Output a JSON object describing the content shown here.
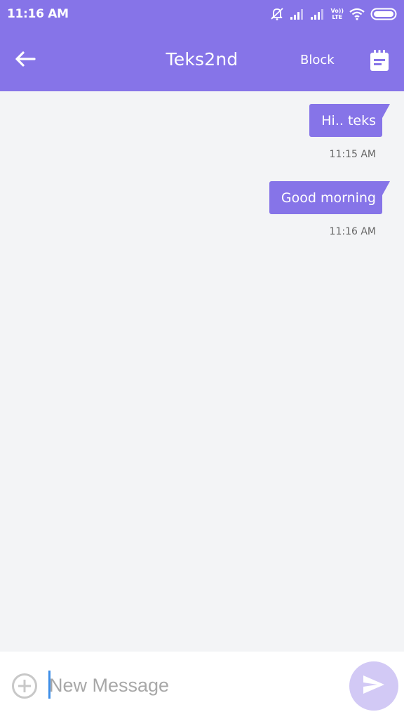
{
  "status_bar": {
    "time": "11:16 AM",
    "icons": [
      "bell-muted-icon",
      "signal-icon",
      "signal-icon",
      "volte-icon",
      "wifi-icon",
      "battery-icon"
    ],
    "volte_label_top": "Vo))",
    "volte_label_bottom": "LTE"
  },
  "app_bar": {
    "back_icon": "arrow-left-icon",
    "title": "Teks2nd",
    "block_label": "Block",
    "calendar_icon": "calendar-icon"
  },
  "messages": [
    {
      "text": "Hi.. teks",
      "time": "11:15 AM",
      "direction": "outgoing"
    },
    {
      "text": "Good morning",
      "time": "11:16 AM",
      "direction": "outgoing"
    }
  ],
  "composer": {
    "attach_icon": "plus-circle-icon",
    "value": "",
    "placeholder": "New Message",
    "send_icon": "send-icon"
  },
  "colors": {
    "primary": "#8674e8",
    "background": "#f3f4f6",
    "send_button_disabled": "#d2c9f5",
    "caret": "#3d8ee8"
  }
}
